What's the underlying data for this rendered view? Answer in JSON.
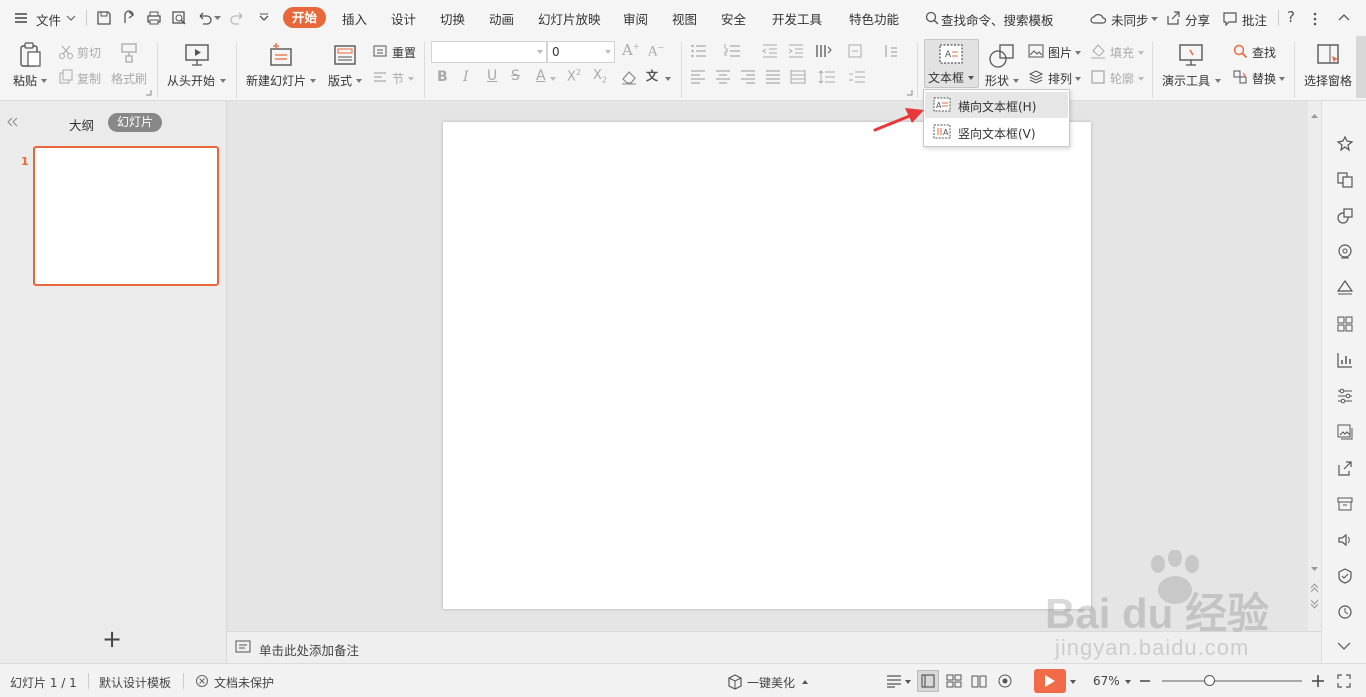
{
  "menubar": {
    "file_label": "文件",
    "tabs": [
      "开始",
      "插入",
      "设计",
      "切换",
      "动画",
      "幻灯片放映",
      "审阅",
      "视图",
      "安全",
      "开发工具",
      "特色功能"
    ],
    "search_label": "查找命令、搜索模板",
    "sync_label": "未同步",
    "share_label": "分享",
    "comment_label": "批注",
    "help_label": "?"
  },
  "ribbon": {
    "paste": "粘贴",
    "cut": "剪切",
    "copy": "复制",
    "format_painter": "格式刷",
    "from_start": "从头开始",
    "new_slide": "新建幻灯片",
    "layout": "版式",
    "reset": "重置",
    "section": "节",
    "font_size": "0",
    "textbox": "文本框",
    "shape": "形状",
    "picture": "图片",
    "fill": "填充",
    "arrange": "排列",
    "outline": "轮廓",
    "present_tools": "演示工具",
    "find": "查找",
    "replace": "替换",
    "select_pane": "选择窗格"
  },
  "dropdown": {
    "items": [
      "横向文本框(H)",
      "竖向文本框(V)"
    ]
  },
  "leftpanel": {
    "tab_outline": "大纲",
    "tab_slides": "幻灯片",
    "slide_number": "1",
    "add_label": "+"
  },
  "notes": {
    "placeholder": "单击此处添加备注"
  },
  "statusbar": {
    "slide_info": "幻灯片 1 / 1",
    "template": "默认设计模板",
    "protect": "文档未保护",
    "beautify": "一键美化",
    "zoom": "67%",
    "zoom_fraction": 0.67
  },
  "watermark": {
    "brand": "Bai du 经验",
    "url": "jingyan.baidu.com"
  },
  "colors": {
    "accent": "#e9683b",
    "arrow": "#e8383b",
    "play": "#f26b48"
  }
}
